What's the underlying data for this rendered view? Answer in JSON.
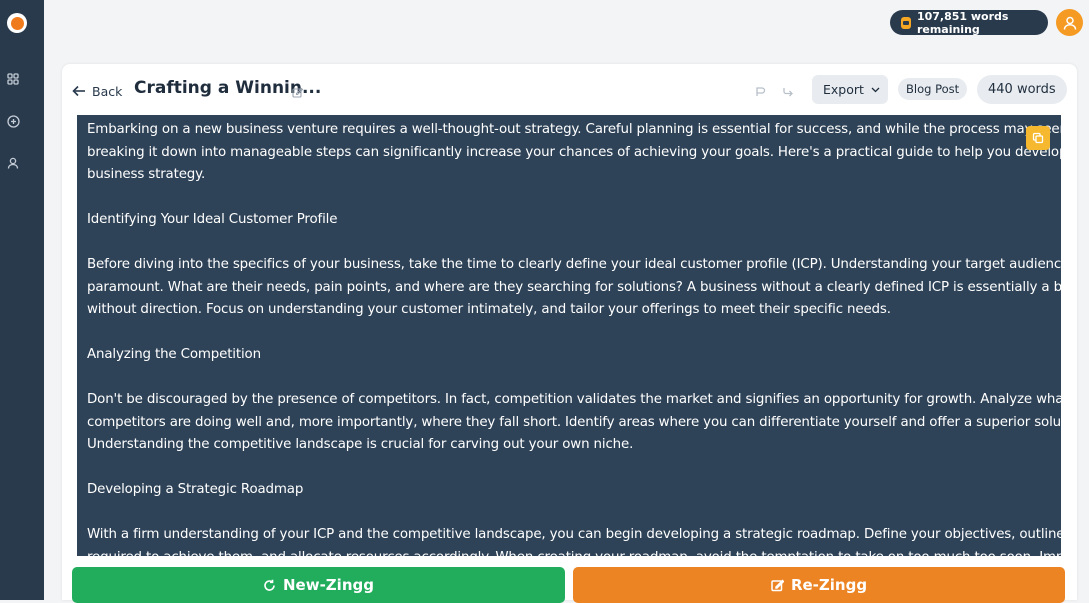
{
  "top_bar": {
    "words_remaining": "107,851 words remaining"
  },
  "sidebar": {
    "icons": [
      "grid-icon",
      "plus-circle-icon",
      "user-icon"
    ]
  },
  "toolbar": {
    "back_label": "Back",
    "title": "Crafting a Winnin...",
    "export_label": "Export",
    "type_badge": "Blog Post",
    "word_count": "440 words"
  },
  "editor": {
    "paragraphs": [
      "Embarking on a new business venture requires a well-thought-out strategy. Careful planning is essential for success, and while the process may seem daunting,\nbreaking it down into manageable steps can significantly increase your chances of achieving your goals. Here's a practical guide to help you develop a winning\nbusiness strategy.",
      "Identifying Your Ideal Customer Profile",
      "Before diving into the specifics of your business, take the time to clearly define your ideal customer profile (ICP). Understanding your target audience is\nparamount. What are their needs, pain points, and where are they searching for solutions? A business without a clearly defined ICP is essentially a business\nwithout direction. Focus on understanding your customer intimately, and tailor your offerings to meet their specific needs.",
      "Analyzing the Competition",
      "Don't be discouraged by the presence of competitors. In fact, competition validates the market and signifies an opportunity for growth. Analyze what your\ncompetitors are doing well and, more importantly, where they fall short. Identify areas where you can differentiate yourself and offer a superior solution.\nUnderstanding the competitive landscape is crucial for carving out your own niche.",
      "Developing a Strategic Roadmap",
      "With a firm understanding of your ICP and the competitive landscape, you can begin developing a strategic roadmap. Define your objectives, outline the steps\nrequired to achieve them, and allocate resources accordingly. When creating your roadmap, avoid the temptation to take on too much too soon. Implement a"
    ]
  },
  "actions": {
    "new_label": "New-Zingg",
    "re_label": "Re-Zingg"
  },
  "colors": {
    "sidebar_bg": "#2a3a4d",
    "editor_bg": "#2f4358",
    "new_button": "#22ad5c",
    "re_button": "#ec8424",
    "accent": "#f07b1c"
  }
}
